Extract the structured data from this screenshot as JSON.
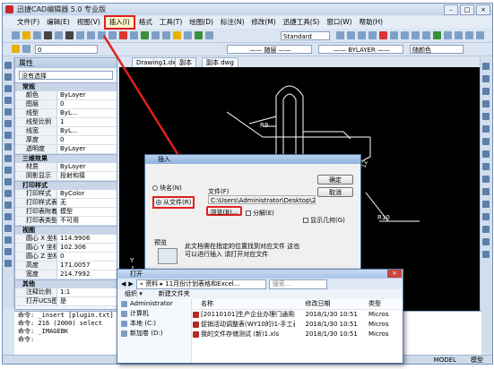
{
  "window": {
    "title": "迅捷CAD编辑器 5.0 专业版"
  },
  "menubar": [
    "文件(F)",
    "编辑(E)",
    "视图(V)",
    "插入(I)",
    "格式",
    "工具(T)",
    "绘图(D)",
    "标注(N)",
    "修改(M)",
    "迅捷工具(S)",
    "窗口(W)",
    "帮助(H)"
  ],
  "toolbar": {
    "standard_combo": "Standard",
    "linetype_combo": "—— 随层 ——",
    "lineweight_combo": "—— BYLAYER ——",
    "color_combo": "随颜色"
  },
  "layer_combo": "0",
  "doc_tabs": [
    "Drawing1.dwg",
    "副本",
    "副本 dwg"
  ],
  "properties": {
    "title": "属性",
    "selection": "没有选择",
    "groups": [
      {
        "name": "常规",
        "rows": [
          [
            "颜色",
            "ByLayer"
          ],
          [
            "图层",
            "0"
          ],
          [
            "线型",
            "ByL..."
          ],
          [
            "线型比例",
            "1"
          ],
          [
            "线宽",
            "ByL..."
          ],
          [
            "厚度",
            "0"
          ],
          [
            "透明度",
            "ByLayer"
          ]
        ]
      },
      {
        "name": "三维效果",
        "rows": [
          [
            "材质",
            "ByLayer"
          ],
          [
            "阴影显示",
            "投射和接"
          ]
        ]
      },
      {
        "name": "打印样式",
        "rows": [
          [
            "打印样式",
            "ByColor"
          ],
          [
            "打印样式表",
            "无"
          ],
          [
            "打印表附着到",
            "模型"
          ],
          [
            "打印表类型",
            "不可用"
          ]
        ]
      },
      {
        "name": "视图",
        "rows": [
          [
            "圆心 X 坐标",
            "114.9906"
          ],
          [
            "圆心 Y 坐标",
            "102.306"
          ],
          [
            "圆心 Z 坐标",
            "0"
          ],
          [
            "高度",
            "171.0057"
          ],
          [
            "宽度",
            "214.7992"
          ]
        ]
      },
      {
        "name": "其他",
        "rows": [
          [
            "注释比例",
            "1:1"
          ],
          [
            "打开UCS图标",
            "是"
          ]
        ]
      }
    ]
  },
  "canvas": {
    "dim_r9": "R9",
    "dim_r10": "R10",
    "dim_12": "12",
    "axis_y": "Y"
  },
  "command_lines": [
    "命令: _insert [plugin.txt] (关于插",
    "命令: 216 (2000) select",
    "命令: _IMAGEBK",
    "命令:"
  ],
  "status": {
    "model": "MODEL",
    "extra": "模型"
  },
  "dialog": {
    "title": "插入",
    "from_block": "块名(N)",
    "from_file": "从文件(R)",
    "file_label": "文件(F)",
    "path": "C:\\Users\\Administrator\\Desktop\\2",
    "browse": "浏览(B)...",
    "explode": "分解(E)",
    "uniform": "显示几何(G)",
    "ok": "确定",
    "cancel": "取消",
    "preview": "预览",
    "hint": "此文档需在指定的位置找到对应文件 这也\n可以进行插入 请打开对应文件"
  },
  "explorer": {
    "title": "打开",
    "path": "« 资料 ▸ 11月份计划表格和Excel...",
    "search": "搜索...",
    "organize": "组织 ▾",
    "new_folder": "新建文件夹",
    "nav": [
      "Administrator",
      "计算机",
      "本地 (C:)",
      "新加卷 (D:)"
    ],
    "columns": [
      "名称",
      "修改日期",
      "类型"
    ],
    "files": [
      {
        "name": "[20110101]生产企业办理门通用报批...",
        "date": "2018/1/30 10:51",
        "type": "Micros"
      },
      {
        "name": "促销活动调整表(WY10的)1-手工表格...",
        "date": "2018/1/30 10:51",
        "type": "Micros"
      },
      {
        "name": "我的文件存储测试 (新)1.xls",
        "date": "2018/1/30 10:51",
        "type": "Micros"
      }
    ]
  },
  "colors": {
    "annotation": "#e02020",
    "canvas": "#000000",
    "chrome": "#d9e4f1"
  }
}
